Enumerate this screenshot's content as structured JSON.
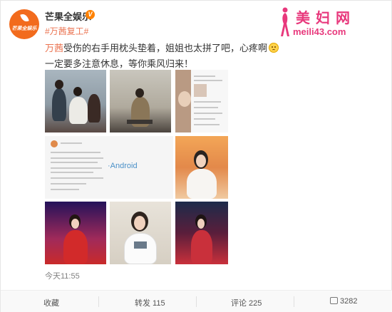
{
  "post": {
    "username": "芒果全娱乐",
    "verified_mark": "V",
    "avatar_text": "芒果全娱乐",
    "hashtag": "#万茜复工#",
    "text": {
      "mention": "万茜",
      "line1_rest": "受伤的右手用枕头垫着，姐姐也太拼了吧，心疼啊",
      "line2": "一定要多注意休息，等你乘风归来！"
    },
    "timestamp": "今天11:55"
  },
  "media": {
    "android_label": "·Android"
  },
  "actions": {
    "favorite": "收藏",
    "repost": "转发 115",
    "comment": "评论 225",
    "like": "3282"
  },
  "watermark": {
    "title": "美妇网",
    "url": "meili43.com"
  },
  "colors": {
    "brand_orange": "#f26b1d",
    "link": "#eb7350",
    "watermark_pink": "#e8387c"
  }
}
